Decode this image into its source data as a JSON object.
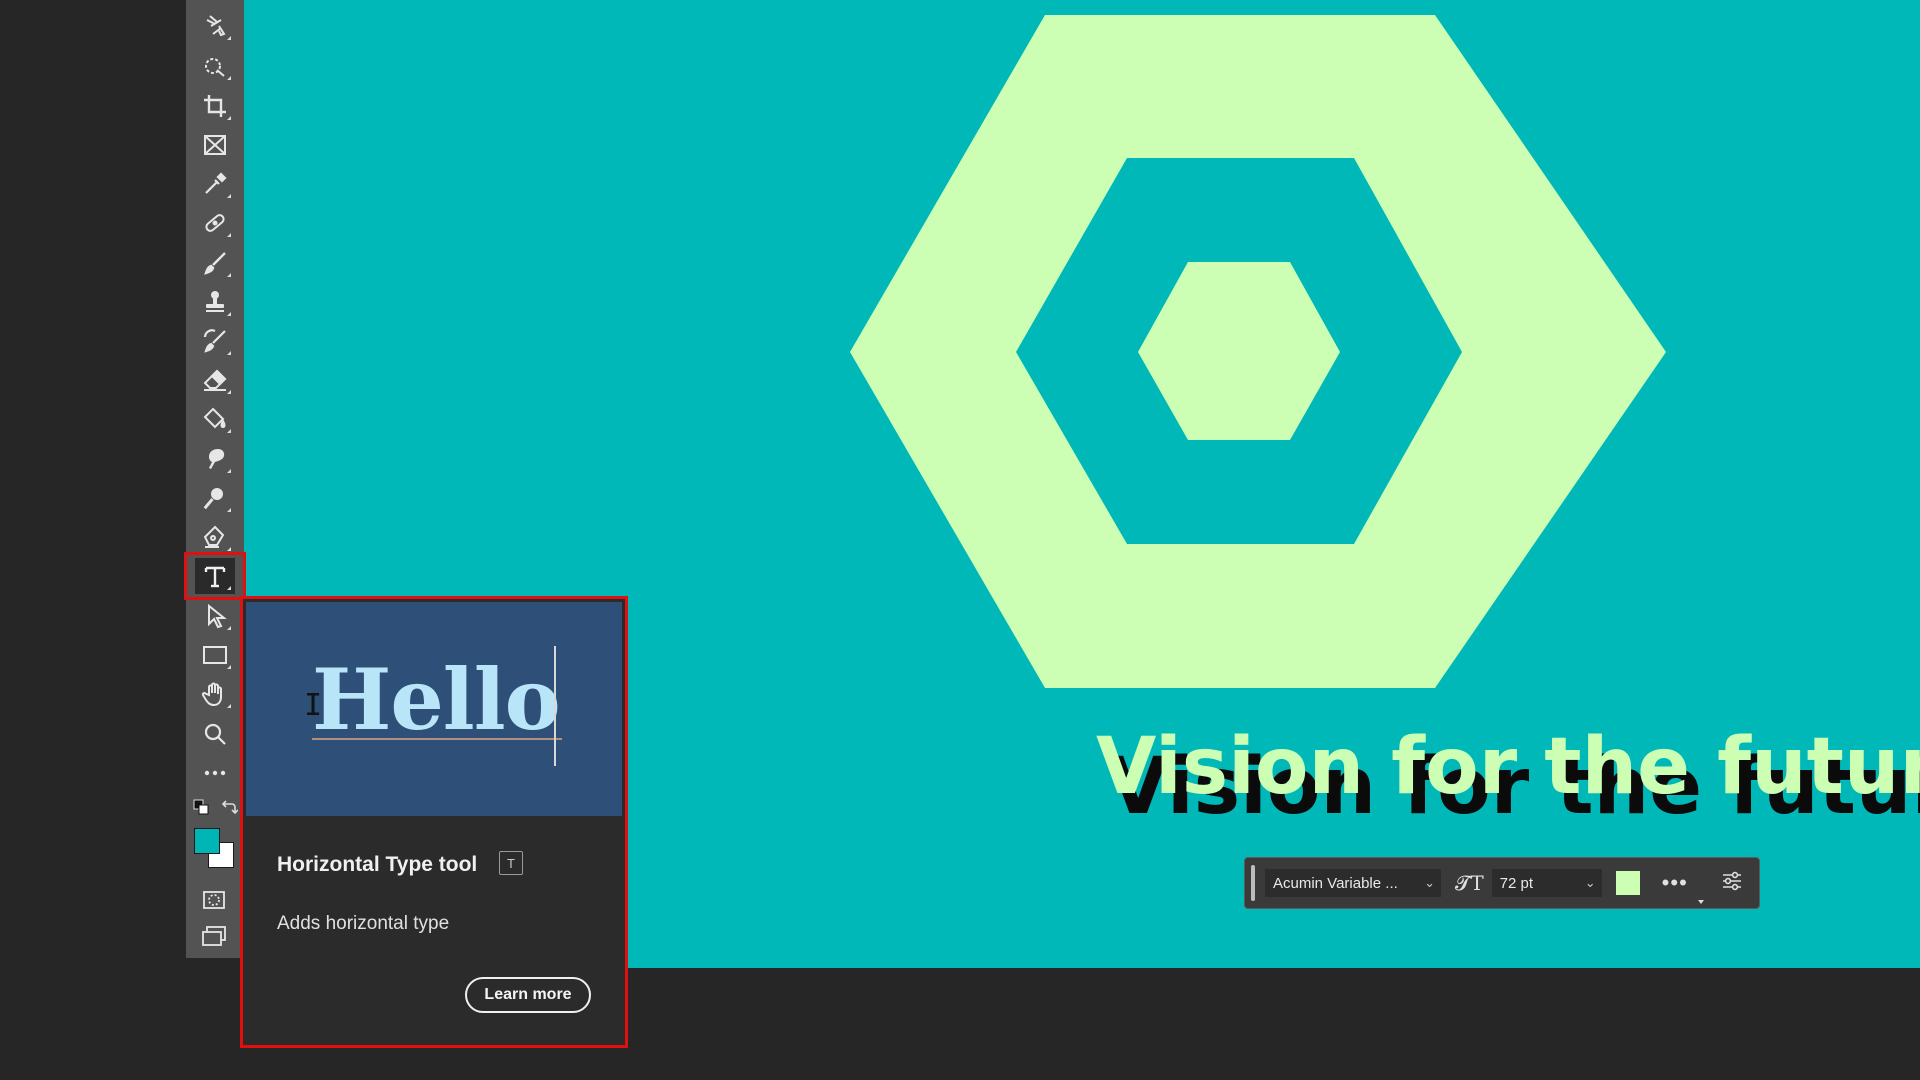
{
  "tools": [
    {
      "name": "object-selection-tool",
      "icon": "object-select-icon"
    },
    {
      "name": "quick-selection-tool",
      "icon": "quick-select-icon"
    },
    {
      "name": "crop-tool",
      "icon": "crop-icon"
    },
    {
      "name": "frame-tool",
      "icon": "frame-icon"
    },
    {
      "name": "eyedropper-tool",
      "icon": "eyedropper-icon"
    },
    {
      "name": "spot-healing-tool",
      "icon": "bandage-icon"
    },
    {
      "name": "brush-tool",
      "icon": "brush-icon"
    },
    {
      "name": "clone-stamp-tool",
      "icon": "stamp-icon"
    },
    {
      "name": "history-brush-tool",
      "icon": "history-brush-icon"
    },
    {
      "name": "eraser-tool",
      "icon": "eraser-icon"
    },
    {
      "name": "paint-bucket-tool",
      "icon": "bucket-icon"
    },
    {
      "name": "smudge-tool",
      "icon": "smudge-icon"
    },
    {
      "name": "dodge-tool",
      "icon": "dodge-icon"
    },
    {
      "name": "pen-tool",
      "icon": "pen-icon"
    },
    {
      "name": "type-tool",
      "icon": "type-icon"
    },
    {
      "name": "path-selection-tool",
      "icon": "arrow-icon"
    },
    {
      "name": "rectangle-tool",
      "icon": "rectangle-icon"
    },
    {
      "name": "hand-tool",
      "icon": "hand-icon"
    },
    {
      "name": "zoom-tool",
      "icon": "zoom-icon"
    },
    {
      "name": "more-tools",
      "icon": "more-icon"
    }
  ],
  "colors": {
    "canvas": "#00b8b8",
    "shape": "#ccffb4",
    "foreground": "#00b5b5",
    "background": "#ffffff",
    "highlight": "#e01010"
  },
  "artwork": {
    "headline": "Vision for the future"
  },
  "context_bar": {
    "font_family": "Acumin Variable ...",
    "font_size": "72 pt",
    "color_swatch": "#ccffb4"
  },
  "tooltip": {
    "preview_text": "Hello",
    "title": "Horizontal Type tool",
    "shortcut": "T",
    "description": "Adds horizontal type",
    "learn_more": "Learn more"
  }
}
